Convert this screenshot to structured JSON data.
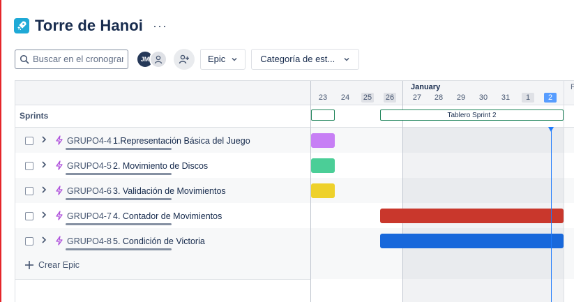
{
  "header": {
    "title": "Torre de Hanoi",
    "more_label": "···"
  },
  "toolbar": {
    "search_placeholder": "Buscar en el cronograma",
    "avatar_initials": "JM",
    "epic_dropdown": "Epic",
    "category_dropdown": "Categoría de est..."
  },
  "timeline": {
    "month": "January",
    "next_month_initial": "F",
    "days": [
      "23",
      "24",
      "25",
      "26",
      "27",
      "28",
      "29",
      "30",
      "31",
      "1",
      "2"
    ],
    "weekend_days": [
      "25",
      "26",
      "1"
    ],
    "today": "2"
  },
  "sprints": {
    "label": "Sprints",
    "items": [
      {
        "name": ""
      },
      {
        "name": "Tablero Sprint 2"
      }
    ]
  },
  "epics": [
    {
      "key": "GRUPO4-4",
      "title": "1.Representación Básica del Juego",
      "color": "#c77ff5"
    },
    {
      "key": "GRUPO4-5",
      "title": "2. Movimiento de Discos",
      "color": "#4bce97"
    },
    {
      "key": "GRUPO4-6",
      "title": "3. Validación de Movimientos",
      "color": "#eed12b"
    },
    {
      "key": "GRUPO4-7",
      "title": "4. Contador de Movimientos",
      "color": "#c9372c"
    },
    {
      "key": "GRUPO4-8",
      "title": "5. Condición de Victoria",
      "color": "#1868db"
    }
  ],
  "create_epic_label": "Crear Epic",
  "colors": {
    "today": "#1d7afc",
    "sprint_border": "#1f845a",
    "epic_icon": "#ae4fdb"
  }
}
